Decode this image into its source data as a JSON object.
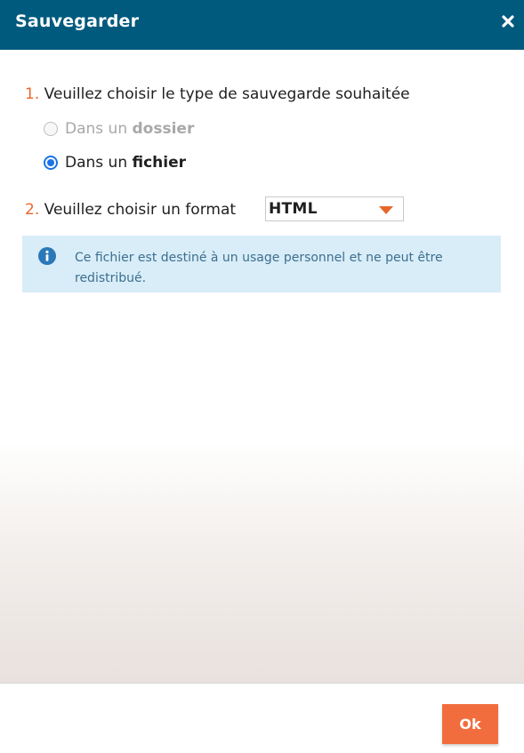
{
  "dialog": {
    "title": "Sauvegarder",
    "close_icon": "close-icon"
  },
  "step1": {
    "number": "1.",
    "label": "Veuillez choisir le type de sauvegarde souhaitée",
    "options": [
      {
        "prefix": "Dans un ",
        "emphasis": "dossier",
        "selected": false,
        "disabled": true
      },
      {
        "prefix": "Dans un ",
        "emphasis": "fichier",
        "selected": true,
        "disabled": false
      }
    ]
  },
  "step2": {
    "number": "2.",
    "label": "Veuillez choisir un format",
    "format_value": "HTML"
  },
  "info": {
    "icon": "info-icon",
    "text": "Ce fichier est destiné à un usage personnel et ne peut être redistribué."
  },
  "footer": {
    "ok_label": "Ok"
  },
  "colors": {
    "header": "#005a7d",
    "accent_orange": "#e8662c",
    "button_orange": "#f26d3d",
    "radio_blue": "#1a73e8",
    "info_background": "#d9edf8",
    "info_text": "#3c6f8f"
  }
}
